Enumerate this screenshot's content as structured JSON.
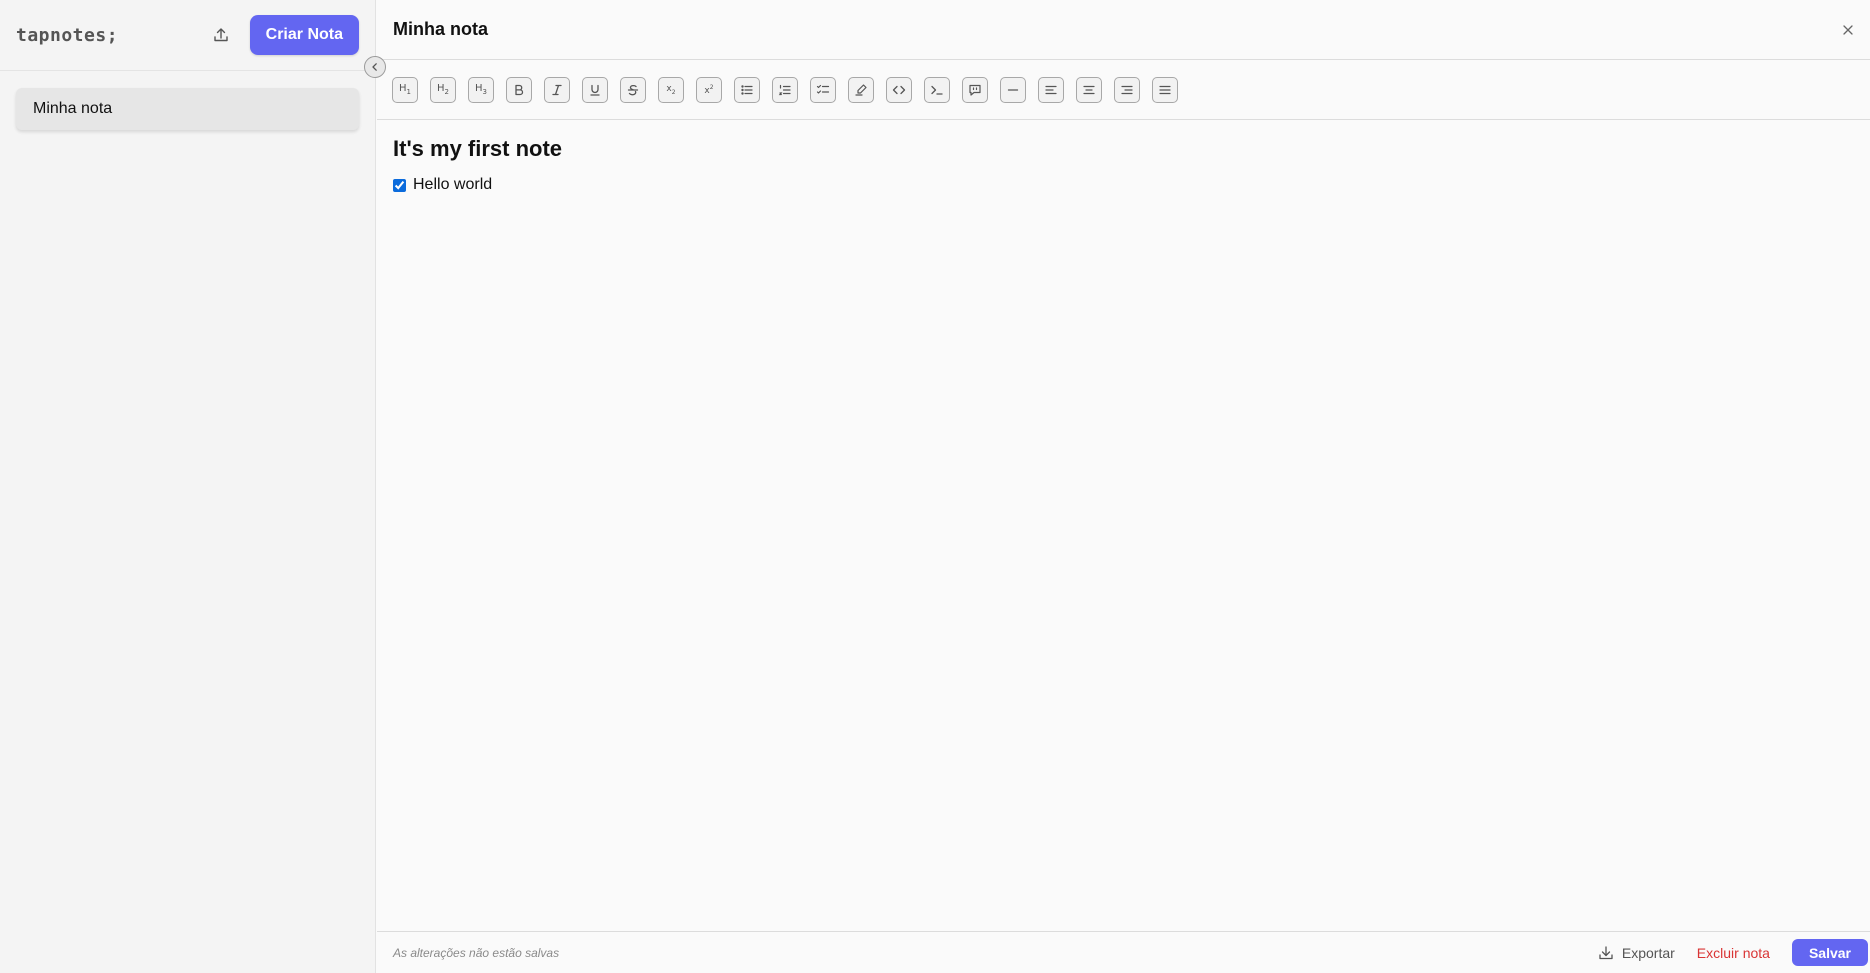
{
  "app": {
    "brand": "tapnotes;"
  },
  "sidebar": {
    "create_label": "Criar Nota",
    "notes": [
      {
        "title": "Minha nota"
      }
    ]
  },
  "note": {
    "title": "Minha nota",
    "heading": "It's my first note",
    "task": {
      "text": "Hello world",
      "checked": true
    }
  },
  "toolbar": {
    "buttons": [
      "h1-icon",
      "h2-icon",
      "h3-icon",
      "bold-icon",
      "italic-icon",
      "underline-icon",
      "strikethrough-icon",
      "subscript-icon",
      "superscript-icon",
      "bullet-list-icon",
      "ordered-list-icon",
      "task-list-icon",
      "highlight-icon",
      "code-icon",
      "code-block-icon",
      "blockquote-icon",
      "horizontal-rule-icon",
      "align-left-icon",
      "align-center-icon",
      "align-right-icon",
      "align-justify-icon"
    ]
  },
  "footer": {
    "status": "As alterações não estão salvas",
    "export_label": "Exportar",
    "delete_label": "Excluir nota",
    "save_label": "Salvar"
  },
  "colors": {
    "accent": "#6366f1",
    "danger": "#d93535",
    "checkbox": "#0b6bdc"
  }
}
